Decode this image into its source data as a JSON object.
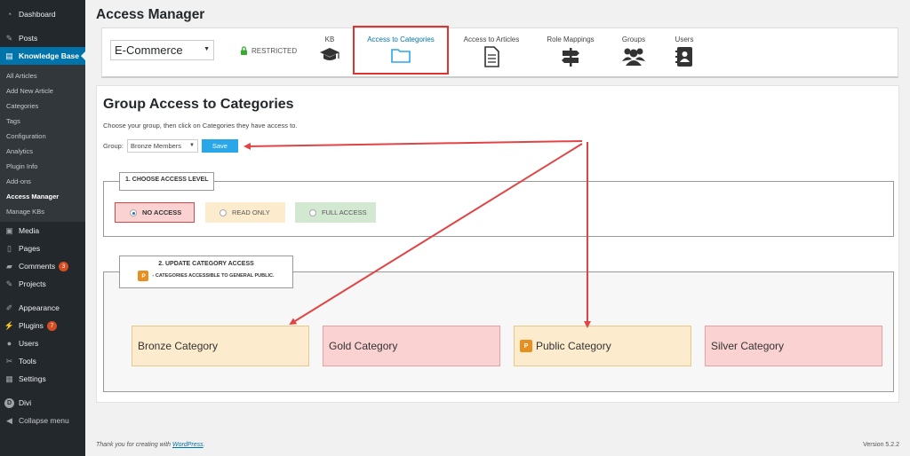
{
  "sidebar": {
    "dashboard": "Dashboard",
    "posts": "Posts",
    "knowledge_base": "Knowledge Base",
    "submenu": [
      "All Articles",
      "Add New Article",
      "Categories",
      "Tags",
      "Configuration",
      "Analytics",
      "Plugin Info",
      "Add-ons",
      "Access Manager",
      "Manage KBs"
    ],
    "media": "Media",
    "pages": "Pages",
    "comments": "Comments",
    "comments_count": "3",
    "projects": "Projects",
    "appearance": "Appearance",
    "plugins": "Plugins",
    "plugins_count": "7",
    "users": "Users",
    "tools": "Tools",
    "settings": "Settings",
    "divi": "Divi",
    "collapse": "Collapse menu"
  },
  "page_title": "Access Manager",
  "topbar": {
    "kb_select": "E-Commerce",
    "restricted": "RESTRICTED",
    "tabs": [
      "KB",
      "Access to Categories",
      "Access to Articles",
      "Role Mappings",
      "Groups",
      "Users"
    ]
  },
  "content": {
    "title": "Group Access to Categories",
    "instructions": "Choose your group, then click on Categories they have access to.",
    "group_label": "Group:",
    "group_value": "Bronze Members",
    "save": "Save",
    "step1": "1. CHOOSE ACCESS LEVEL",
    "access_levels": [
      "NO ACCESS",
      "READ ONLY",
      "FULL ACCESS"
    ],
    "step2": "2. UPDATE CATEGORY ACCESS",
    "p_badge": "P",
    "p_note": "- CATEGORIES ACCESSIBLE TO GENERAL PUBLIC.",
    "categories": [
      "Bronze Category",
      "Gold Category",
      "Public Category",
      "Silver Category"
    ]
  },
  "footer": {
    "thanks_prefix": "Thank you for creating with ",
    "wordpress": "WordPress",
    "thanks_suffix": ".",
    "version": "Version 5.2.2"
  },
  "colors": {
    "sidebar_bg": "#23282d",
    "active_blue": "#0073aa",
    "save_blue": "#29a7e8",
    "highlight_red": "#dd3333",
    "no_access_bg": "#fbd2d2",
    "read_only_bg": "#fdebcd",
    "full_access_bg": "#d2e8d0",
    "public_badge": "#e8901f"
  }
}
